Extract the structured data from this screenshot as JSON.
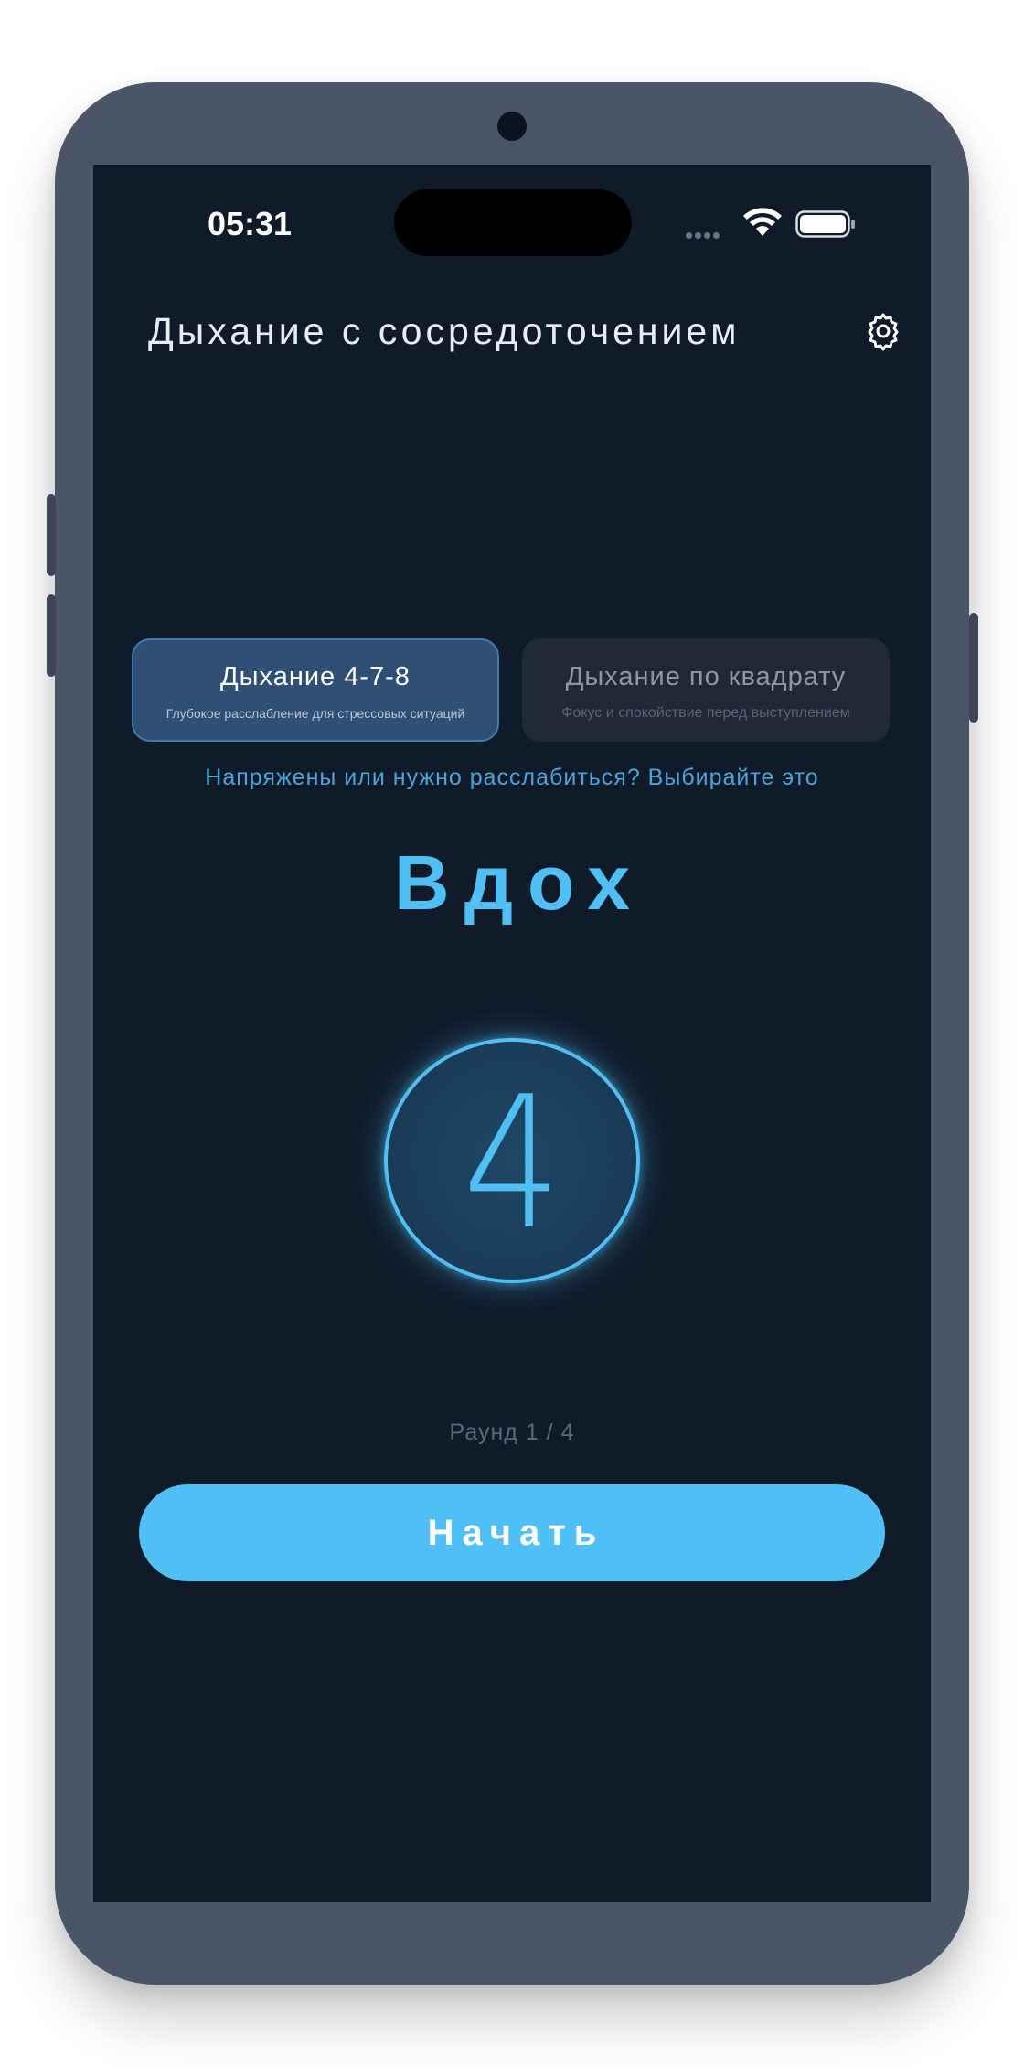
{
  "status_bar": {
    "time": "05:31",
    "signal_icon": "signal-dots-icon",
    "wifi_icon": "wifi-icon",
    "battery_icon": "battery-icon"
  },
  "header": {
    "title": "Дыхание с сосредоточением",
    "settings_icon": "gear-icon"
  },
  "techniques": [
    {
      "title": "Дыхание 4-7-8",
      "subtitle": "Глубокое расслабление для стрессовых ситуаций",
      "selected": true
    },
    {
      "title": "Дыхание по квадрату",
      "subtitle": "Фокус и спокойствие перед выступлением",
      "selected": false
    }
  ],
  "hint": "Напряжены или нужно расслабиться? Выбирайте это",
  "phase": "Вдох",
  "counter": "4",
  "round": "Раунд 1 / 4",
  "start_button": "Начать",
  "colors": {
    "accent": "#4fc0f5",
    "screen_bg": "#101b2a",
    "card_active": "#2f4f74",
    "card_inactive": "#1f2937",
    "frame": "#4b5568"
  }
}
